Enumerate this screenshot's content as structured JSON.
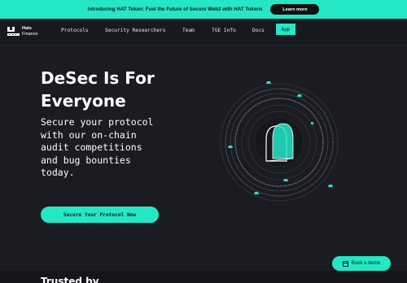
{
  "announcement": {
    "text": "Introducing HAT Token: Fuel the Future of Secure Web3 with HAT Tokens",
    "button_label": "Learn more"
  },
  "logo": {
    "line1": "Hats",
    "line2": "Finance"
  },
  "nav": {
    "items": [
      {
        "label": "Protocols"
      },
      {
        "label": "Security Researchers"
      },
      {
        "label": "Team"
      },
      {
        "label": "TGE Info"
      },
      {
        "label": "Docs"
      }
    ],
    "app_label": "App"
  },
  "hero": {
    "title": "DeSec Is For Everyone",
    "subtitle": "Secure your protocol with our on-chain audit competitions and bug bounties today.",
    "cta_label": "Secure Your Protocol Now"
  },
  "section": {
    "heading": "Trusted by"
  },
  "floating": {
    "demo_label": "Book a demo"
  },
  "colors": {
    "accent": "#24e8c5",
    "background": "#1a1c21",
    "nav": "#17191f"
  }
}
